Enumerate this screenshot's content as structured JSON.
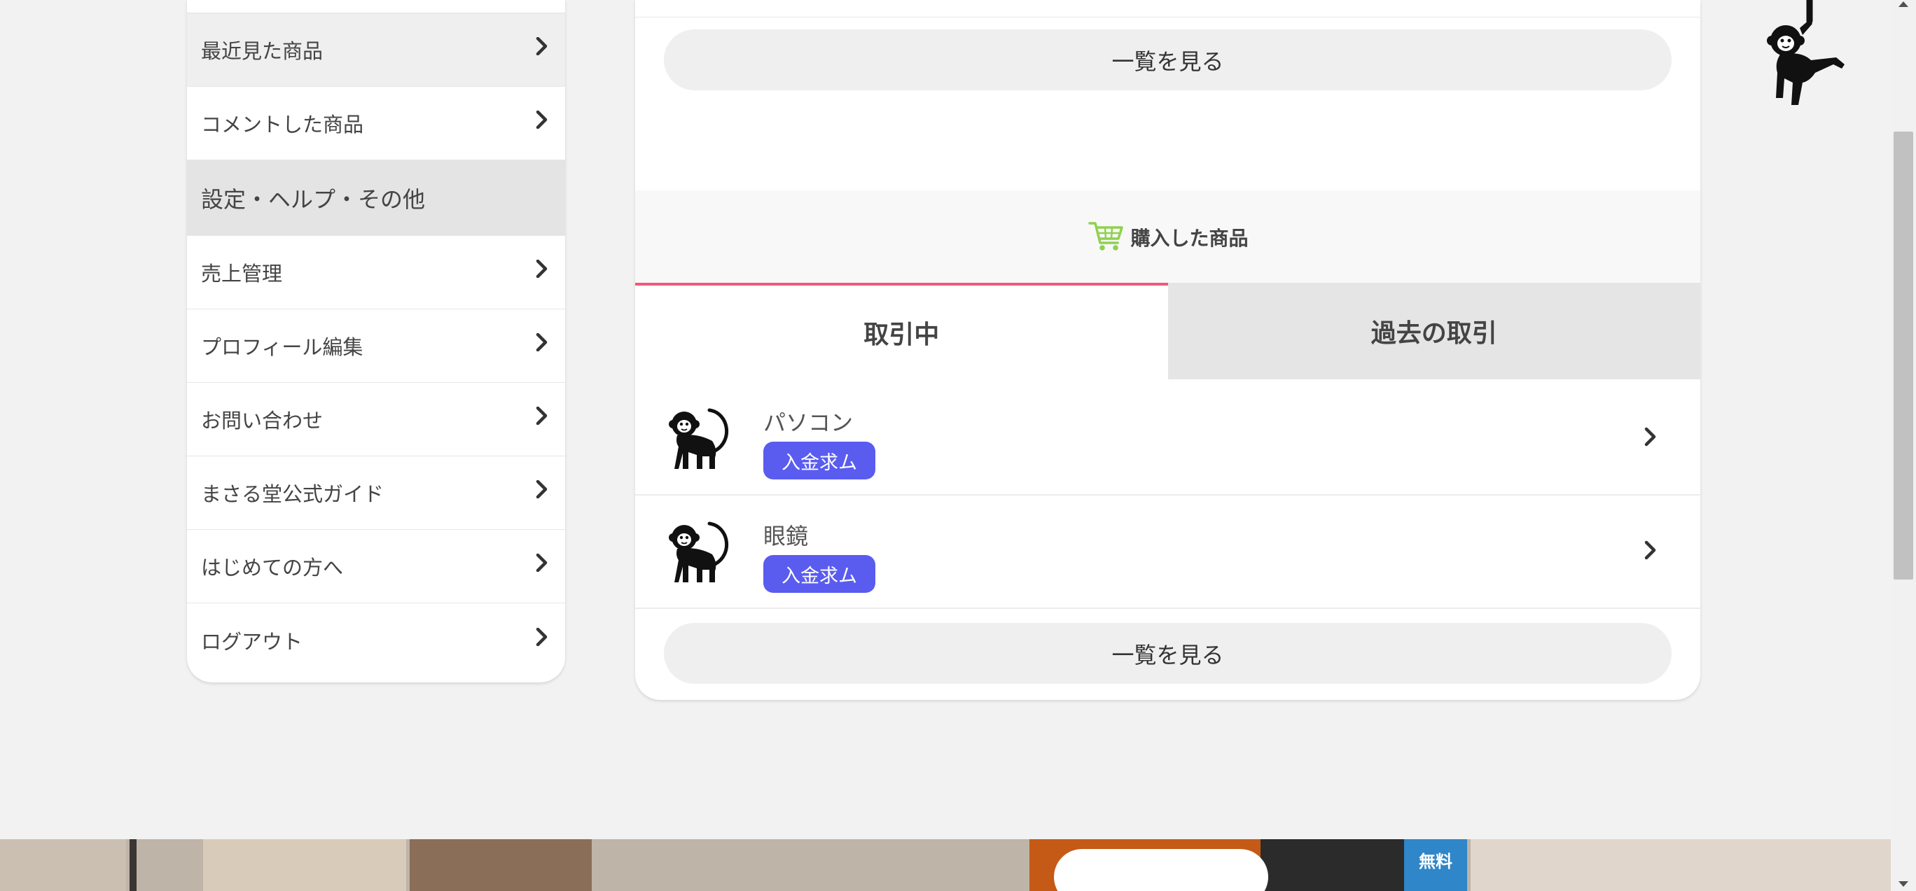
{
  "sidebar": {
    "items": [
      {
        "label": "最近見た商品"
      },
      {
        "label": "コメントした商品"
      }
    ],
    "section_heading": "設定・ヘルプ・その他",
    "settings_items": [
      {
        "label": "売上管理"
      },
      {
        "label": "プロフィール編集"
      },
      {
        "label": "お問い合わせ"
      },
      {
        "label": "まさる堂公式ガイド"
      },
      {
        "label": "はじめての方へ"
      },
      {
        "label": "ログアウト"
      }
    ]
  },
  "main": {
    "see_all_label": "一覧を見る",
    "purchased_section": {
      "title": "購入した商品",
      "icon": "cart-icon",
      "tabs": [
        {
          "label": "取引中",
          "active": true
        },
        {
          "label": "過去の取引",
          "active": false
        }
      ],
      "trades": [
        {
          "name": "パソコン",
          "status": "入金求ム",
          "icon": "monkey-icon"
        },
        {
          "name": "眼鏡",
          "status": "入金求ム",
          "icon": "monkey-icon"
        }
      ],
      "see_all_label": "一覧を見る"
    }
  },
  "banner": {
    "free_badge": "無料"
  },
  "colors": {
    "accent_tab": "#ef5a78",
    "status_badge": "#5a5cf0",
    "cart_icon": "#8fd14f"
  }
}
